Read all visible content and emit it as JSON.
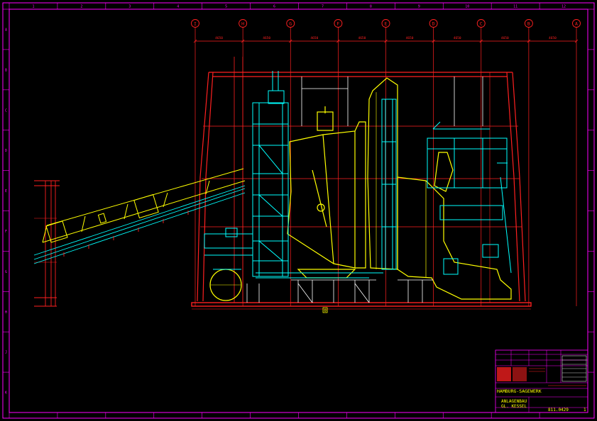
{
  "colors": {
    "background": "#000000",
    "border": "#ff00ff",
    "grid": "#ff2020",
    "frame": "#ff2020",
    "piping": "#00ffff",
    "boiler": "#ffff00",
    "structure": "#ffffff"
  },
  "border": {
    "columns": [
      "1",
      "2",
      "3",
      "4",
      "5",
      "6",
      "7",
      "8",
      "9",
      "10",
      "11",
      "12"
    ],
    "rows": [
      "A",
      "B",
      "C",
      "D",
      "E",
      "F",
      "G",
      "H",
      "J",
      "K"
    ]
  },
  "axes": {
    "labels": [
      "I",
      "H",
      "G",
      "F",
      "E",
      "D",
      "C",
      "B",
      "A"
    ],
    "spacings": [
      "4650",
      "4650",
      "4650",
      "4650",
      "4650",
      "4650",
      "4650",
      "4650"
    ]
  },
  "drawing": {
    "foundation_mark": "0"
  },
  "title_block": {
    "company": "HAMBURG-SAGEWERK",
    "subtitle_1": "ANLAGENBAU",
    "subtitle_2": "GL. KESSEL",
    "drawing_number": "811.0429",
    "sheet": "1"
  }
}
